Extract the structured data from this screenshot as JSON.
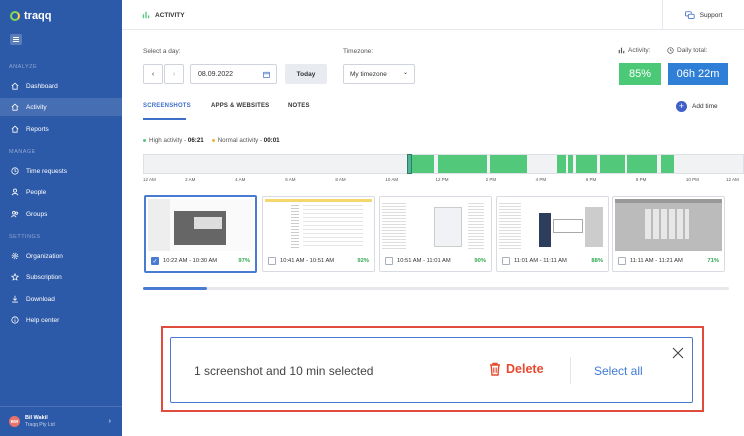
{
  "sidebar": {
    "brand": "traqq",
    "sections": [
      {
        "title": "ANALYZE",
        "items": [
          {
            "label": "Dashboard",
            "icon": "home-icon"
          },
          {
            "label": "Activity",
            "icon": "home-icon",
            "active": true
          },
          {
            "label": "Reports",
            "icon": "home-icon"
          }
        ]
      },
      {
        "title": "MANAGE",
        "items": [
          {
            "label": "Time requests",
            "icon": "clock-icon"
          },
          {
            "label": "People",
            "icon": "people-icon"
          },
          {
            "label": "Groups",
            "icon": "group-icon"
          }
        ]
      },
      {
        "title": "SETTINGS",
        "items": [
          {
            "label": "Organization",
            "icon": "gear-icon"
          },
          {
            "label": "Subscription",
            "icon": "star-icon"
          },
          {
            "label": "Download",
            "icon": "download-icon"
          },
          {
            "label": "Help center",
            "icon": "help-icon"
          }
        ]
      }
    ],
    "user": {
      "initials": "BW",
      "name": "Bil Wakil",
      "org": "Traqq Pty Ltd"
    }
  },
  "header": {
    "title": "ACTIVITY",
    "support_label": "Support"
  },
  "controls": {
    "day_label": "Select a day:",
    "date_value": "08.09.2022",
    "today_label": "Today",
    "timezone_label": "Timezone:",
    "timezone_value": "My timezone",
    "activity_label": "Activity:",
    "activity_value": "85%",
    "daily_total_label": "Daily total:",
    "daily_total_value": "06h 22m",
    "colors": {
      "activity": "#4cc977",
      "total": "#2f7fd6"
    }
  },
  "tabs": [
    {
      "label": "SCREENSHOTS",
      "active": true
    },
    {
      "label": "APPS & WEBSITES"
    },
    {
      "label": "NOTES"
    }
  ],
  "add_time_label": "Add time",
  "legend": {
    "high_label": "High activity -",
    "high_value": "06:21",
    "normal_label": "Normal activity -",
    "normal_value": "00:01",
    "high_color": "#52c97a",
    "normal_color": "#f2b233"
  },
  "timeline": {
    "ticks": [
      "12 AM",
      "2 AM",
      "4 AM",
      "6 AM",
      "8 AM",
      "10 AM",
      "12 PM",
      "2 PM",
      "4 PM",
      "6 PM",
      "8 PM",
      "10 PM",
      "12 AM"
    ],
    "active_spans_hours": [
      [
        10.6,
        11.6
      ],
      [
        11.75,
        13.7
      ],
      [
        13.8,
        15.3
      ],
      [
        16.5,
        16.85
      ],
      [
        16.95,
        17.15
      ],
      [
        17.25,
        18.1
      ],
      [
        18.2,
        19.2
      ],
      [
        19.3,
        20.5
      ],
      [
        20.65,
        21.15
      ]
    ],
    "cursor_hour": 10.5
  },
  "screenshots": [
    {
      "time": "10:22 AM - 10:30 AM",
      "activity": "97%",
      "selected": true
    },
    {
      "time": "10:41 AM - 10:51 AM",
      "activity": "92%",
      "selected": false
    },
    {
      "time": "10:51 AM - 11:01 AM",
      "activity": "90%",
      "selected": false
    },
    {
      "time": "11:01 AM - 11:11 AM",
      "activity": "88%",
      "selected": false
    },
    {
      "time": "11:11 AM - 11:21 AM",
      "activity": "71%",
      "selected": false
    }
  ],
  "selection_bar": {
    "message": "1 screenshot and 10 min selected",
    "delete_label": "Delete",
    "select_all_label": "Select all"
  }
}
